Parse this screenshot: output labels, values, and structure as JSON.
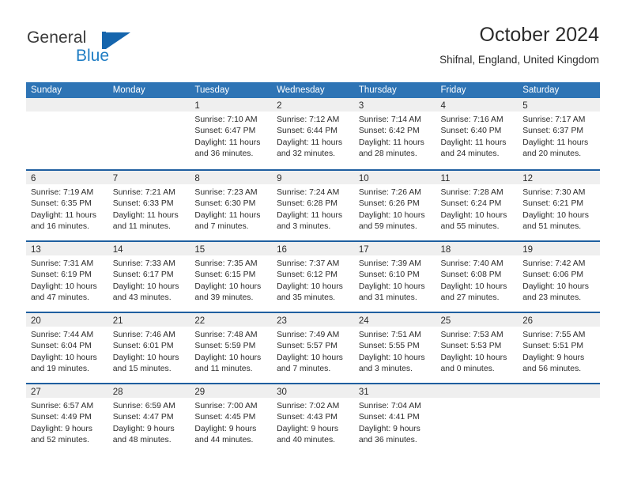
{
  "brand": {
    "name_part1": "General",
    "name_part2": "Blue"
  },
  "header": {
    "title": "October 2024",
    "subtitle": "Shifnal, England, United Kingdom"
  },
  "colors": {
    "header_blue": "#2e74b5",
    "separator_blue": "#1f5fa0",
    "day_band_gray": "#efefef",
    "brand_blue": "#1f7dc4",
    "text": "#2b2b2b"
  },
  "calendar": {
    "day_names": [
      "Sunday",
      "Monday",
      "Tuesday",
      "Wednesday",
      "Thursday",
      "Friday",
      "Saturday"
    ],
    "weeks": [
      [
        {
          "empty": true
        },
        {
          "empty": true
        },
        {
          "day": "1",
          "sunrise": "Sunrise: 7:10 AM",
          "sunset": "Sunset: 6:47 PM",
          "daylight": "Daylight: 11 hours and 36 minutes."
        },
        {
          "day": "2",
          "sunrise": "Sunrise: 7:12 AM",
          "sunset": "Sunset: 6:44 PM",
          "daylight": "Daylight: 11 hours and 32 minutes."
        },
        {
          "day": "3",
          "sunrise": "Sunrise: 7:14 AM",
          "sunset": "Sunset: 6:42 PM",
          "daylight": "Daylight: 11 hours and 28 minutes."
        },
        {
          "day": "4",
          "sunrise": "Sunrise: 7:16 AM",
          "sunset": "Sunset: 6:40 PM",
          "daylight": "Daylight: 11 hours and 24 minutes."
        },
        {
          "day": "5",
          "sunrise": "Sunrise: 7:17 AM",
          "sunset": "Sunset: 6:37 PM",
          "daylight": "Daylight: 11 hours and 20 minutes."
        }
      ],
      [
        {
          "day": "6",
          "sunrise": "Sunrise: 7:19 AM",
          "sunset": "Sunset: 6:35 PM",
          "daylight": "Daylight: 11 hours and 16 minutes."
        },
        {
          "day": "7",
          "sunrise": "Sunrise: 7:21 AM",
          "sunset": "Sunset: 6:33 PM",
          "daylight": "Daylight: 11 hours and 11 minutes."
        },
        {
          "day": "8",
          "sunrise": "Sunrise: 7:23 AM",
          "sunset": "Sunset: 6:30 PM",
          "daylight": "Daylight: 11 hours and 7 minutes."
        },
        {
          "day": "9",
          "sunrise": "Sunrise: 7:24 AM",
          "sunset": "Sunset: 6:28 PM",
          "daylight": "Daylight: 11 hours and 3 minutes."
        },
        {
          "day": "10",
          "sunrise": "Sunrise: 7:26 AM",
          "sunset": "Sunset: 6:26 PM",
          "daylight": "Daylight: 10 hours and 59 minutes."
        },
        {
          "day": "11",
          "sunrise": "Sunrise: 7:28 AM",
          "sunset": "Sunset: 6:24 PM",
          "daylight": "Daylight: 10 hours and 55 minutes."
        },
        {
          "day": "12",
          "sunrise": "Sunrise: 7:30 AM",
          "sunset": "Sunset: 6:21 PM",
          "daylight": "Daylight: 10 hours and 51 minutes."
        }
      ],
      [
        {
          "day": "13",
          "sunrise": "Sunrise: 7:31 AM",
          "sunset": "Sunset: 6:19 PM",
          "daylight": "Daylight: 10 hours and 47 minutes."
        },
        {
          "day": "14",
          "sunrise": "Sunrise: 7:33 AM",
          "sunset": "Sunset: 6:17 PM",
          "daylight": "Daylight: 10 hours and 43 minutes."
        },
        {
          "day": "15",
          "sunrise": "Sunrise: 7:35 AM",
          "sunset": "Sunset: 6:15 PM",
          "daylight": "Daylight: 10 hours and 39 minutes."
        },
        {
          "day": "16",
          "sunrise": "Sunrise: 7:37 AM",
          "sunset": "Sunset: 6:12 PM",
          "daylight": "Daylight: 10 hours and 35 minutes."
        },
        {
          "day": "17",
          "sunrise": "Sunrise: 7:39 AM",
          "sunset": "Sunset: 6:10 PM",
          "daylight": "Daylight: 10 hours and 31 minutes."
        },
        {
          "day": "18",
          "sunrise": "Sunrise: 7:40 AM",
          "sunset": "Sunset: 6:08 PM",
          "daylight": "Daylight: 10 hours and 27 minutes."
        },
        {
          "day": "19",
          "sunrise": "Sunrise: 7:42 AM",
          "sunset": "Sunset: 6:06 PM",
          "daylight": "Daylight: 10 hours and 23 minutes."
        }
      ],
      [
        {
          "day": "20",
          "sunrise": "Sunrise: 7:44 AM",
          "sunset": "Sunset: 6:04 PM",
          "daylight": "Daylight: 10 hours and 19 minutes."
        },
        {
          "day": "21",
          "sunrise": "Sunrise: 7:46 AM",
          "sunset": "Sunset: 6:01 PM",
          "daylight": "Daylight: 10 hours and 15 minutes."
        },
        {
          "day": "22",
          "sunrise": "Sunrise: 7:48 AM",
          "sunset": "Sunset: 5:59 PM",
          "daylight": "Daylight: 10 hours and 11 minutes."
        },
        {
          "day": "23",
          "sunrise": "Sunrise: 7:49 AM",
          "sunset": "Sunset: 5:57 PM",
          "daylight": "Daylight: 10 hours and 7 minutes."
        },
        {
          "day": "24",
          "sunrise": "Sunrise: 7:51 AM",
          "sunset": "Sunset: 5:55 PM",
          "daylight": "Daylight: 10 hours and 3 minutes."
        },
        {
          "day": "25",
          "sunrise": "Sunrise: 7:53 AM",
          "sunset": "Sunset: 5:53 PM",
          "daylight": "Daylight: 10 hours and 0 minutes."
        },
        {
          "day": "26",
          "sunrise": "Sunrise: 7:55 AM",
          "sunset": "Sunset: 5:51 PM",
          "daylight": "Daylight: 9 hours and 56 minutes."
        }
      ],
      [
        {
          "day": "27",
          "sunrise": "Sunrise: 6:57 AM",
          "sunset": "Sunset: 4:49 PM",
          "daylight": "Daylight: 9 hours and 52 minutes."
        },
        {
          "day": "28",
          "sunrise": "Sunrise: 6:59 AM",
          "sunset": "Sunset: 4:47 PM",
          "daylight": "Daylight: 9 hours and 48 minutes."
        },
        {
          "day": "29",
          "sunrise": "Sunrise: 7:00 AM",
          "sunset": "Sunset: 4:45 PM",
          "daylight": "Daylight: 9 hours and 44 minutes."
        },
        {
          "day": "30",
          "sunrise": "Sunrise: 7:02 AM",
          "sunset": "Sunset: 4:43 PM",
          "daylight": "Daylight: 9 hours and 40 minutes."
        },
        {
          "day": "31",
          "sunrise": "Sunrise: 7:04 AM",
          "sunset": "Sunset: 4:41 PM",
          "daylight": "Daylight: 9 hours and 36 minutes."
        },
        {
          "empty": true
        },
        {
          "empty": true
        }
      ]
    ]
  }
}
